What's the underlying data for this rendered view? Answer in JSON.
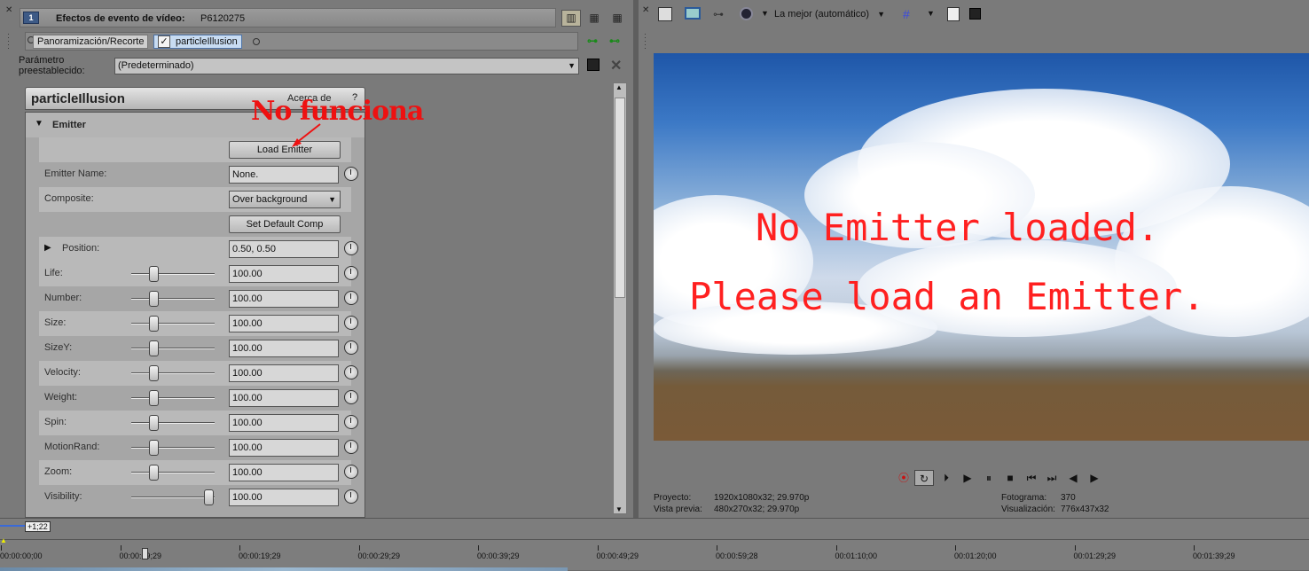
{
  "left_panel": {
    "window_number": "1",
    "title_label": "Efectos de evento de vídeo:",
    "title_value": "P6120275",
    "chain_items": [
      "Panoramización/Recorte",
      "particleIllusion"
    ],
    "preset_label": "Parámetro preestablecido:",
    "preset_value": "(Predeterminado)",
    "plugin_title": "particleIllusion",
    "about_label": "Acerca de",
    "about_q": "?",
    "group_label": "Emitter",
    "load_button": "Load Emitter",
    "set_default_button": "Set Default Comp",
    "annotation": "No funciona",
    "rows": {
      "emitter_name": {
        "label": "Emitter Name:",
        "value": "None."
      },
      "composite": {
        "label": "Composite:",
        "value": "Over background"
      },
      "position": {
        "label": "Position:",
        "value": "0.50, 0.50"
      },
      "life": {
        "label": "Life:",
        "value": "100.00",
        "level": 0.25
      },
      "number": {
        "label": "Number:",
        "value": "100.00",
        "level": 0.25
      },
      "size": {
        "label": "Size:",
        "value": "100.00",
        "level": 0.25
      },
      "sizey": {
        "label": "SizeY:",
        "value": "100.00",
        "level": 0.25
      },
      "velocity": {
        "label": "Velocity:",
        "value": "100.00",
        "level": 0.25
      },
      "weight": {
        "label": "Weight:",
        "value": "100.00",
        "level": 0.25
      },
      "spin": {
        "label": "Spin:",
        "value": "100.00",
        "level": 0.25
      },
      "motionrand": {
        "label": "MotionRand:",
        "value": "100.00",
        "level": 0.25
      },
      "zoom": {
        "label": "Zoom:",
        "value": "100.00",
        "level": 0.25
      },
      "visibility": {
        "label": "Visibility:",
        "value": "100.00",
        "level": 1.0
      }
    }
  },
  "right_panel": {
    "quality": "La mejor (automático)",
    "preview_line1": "No Emitter loaded.",
    "preview_line2": "Please load an Emitter.",
    "info": {
      "proyecto_label": "Proyecto:",
      "proyecto_value": "1920x1080x32; 29.970p",
      "vista_label": "Vista previa:",
      "vista_value": "480x270x32; 29.970p",
      "fotograma_label": "Fotograma:",
      "fotograma_value": "370",
      "visualizacion_label": "Visualización:",
      "visualizacion_value": "776x437x32"
    }
  },
  "timeline": {
    "rate": "+1;22",
    "ticks": [
      "00:00:00;00",
      "00:00:09;29",
      "00:00:19;29",
      "00:00:29;29",
      "00:00:39;29",
      "00:00:49;29",
      "00:00:59;28",
      "00:01:10;00",
      "00:01:20;00",
      "00:01:29;29",
      "00:01:39;29"
    ]
  },
  "colors": {
    "annotation": "#e11111",
    "preview_text": "#ff2020",
    "active_chain": "#c8dcf2"
  }
}
